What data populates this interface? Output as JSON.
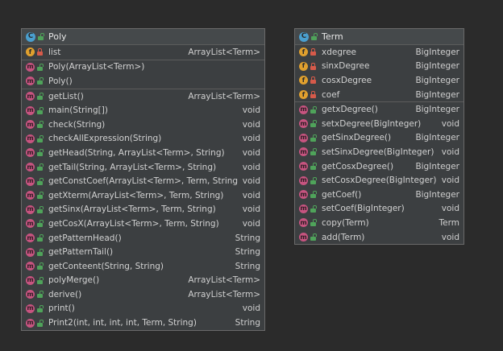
{
  "poly": {
    "title": "Poly",
    "fields": [
      {
        "name": "list",
        "type": "ArrayList<Term>",
        "visibility": "private"
      }
    ],
    "constructors": [
      {
        "name": "Poly(ArrayList<Term>)",
        "type": "",
        "visibility": "public"
      },
      {
        "name": "Poly()",
        "type": "",
        "visibility": "public"
      }
    ],
    "methods": [
      {
        "name": "getList()",
        "type": "ArrayList<Term>",
        "visibility": "public"
      },
      {
        "name": "main(String[])",
        "type": "void",
        "visibility": "public"
      },
      {
        "name": "check(String)",
        "type": "void",
        "visibility": "public"
      },
      {
        "name": "checkAllExpression(String)",
        "type": "void",
        "visibility": "public"
      },
      {
        "name": "getHead(String, ArrayList<Term>, String)",
        "type": "void",
        "visibility": "public"
      },
      {
        "name": "getTail(String, ArrayList<Term>, String)",
        "type": "void",
        "visibility": "public"
      },
      {
        "name": "getConstCoef(ArrayList<Term>, Term, String)",
        "type": "void",
        "visibility": "public"
      },
      {
        "name": "getXterm(ArrayList<Term>, Term, String)",
        "type": "void",
        "visibility": "public"
      },
      {
        "name": "getSinx(ArrayList<Term>, Term, String)",
        "type": "void",
        "visibility": "public"
      },
      {
        "name": "getCosX(ArrayList<Term>, Term, String)",
        "type": "void",
        "visibility": "public"
      },
      {
        "name": "getPatternHead()",
        "type": "String",
        "visibility": "public"
      },
      {
        "name": "getPatternTail()",
        "type": "String",
        "visibility": "public"
      },
      {
        "name": "getConteent(String, String)",
        "type": "String",
        "visibility": "public"
      },
      {
        "name": "polyMerge()",
        "type": "ArrayList<Term>",
        "visibility": "public"
      },
      {
        "name": "derive()",
        "type": "ArrayList<Term>",
        "visibility": "public"
      },
      {
        "name": "print()",
        "type": "void",
        "visibility": "public"
      },
      {
        "name": "Print2(int, int, int, int, Term, String)",
        "type": "String",
        "visibility": "public"
      }
    ]
  },
  "term": {
    "title": "Term",
    "fields": [
      {
        "name": "xdegree",
        "type": "BigInteger",
        "visibility": "private"
      },
      {
        "name": "sinxDegree",
        "type": "BigInteger",
        "visibility": "private"
      },
      {
        "name": "cosxDegree",
        "type": "BigInteger",
        "visibility": "private"
      },
      {
        "name": "coef",
        "type": "BigInteger",
        "visibility": "private"
      }
    ],
    "methods": [
      {
        "name": "getxDegree()",
        "type": "BigInteger",
        "visibility": "public"
      },
      {
        "name": "setxDegree(BigInteger)",
        "type": "void",
        "visibility": "public"
      },
      {
        "name": "getSinxDegree()",
        "type": "BigInteger",
        "visibility": "public"
      },
      {
        "name": "setSinxDegree(BigInteger)",
        "type": "void",
        "visibility": "public"
      },
      {
        "name": "getCosxDegree()",
        "type": "BigInteger",
        "visibility": "public"
      },
      {
        "name": "setCosxDegree(BigInteger)",
        "type": "void",
        "visibility": "public"
      },
      {
        "name": "getCoef()",
        "type": "BigInteger",
        "visibility": "public"
      },
      {
        "name": "setCoef(BigInteger)",
        "type": "void",
        "visibility": "public"
      },
      {
        "name": "copy(Term)",
        "type": "Term",
        "visibility": "public"
      },
      {
        "name": "add(Term)",
        "type": "void",
        "visibility": "public"
      }
    ]
  },
  "icons": {
    "class_letter": "C",
    "field_letter": "f",
    "method_letter": "m"
  },
  "colors": {
    "background": "#2b2b2b",
    "class_icon": "#4a9fcf",
    "field_icon": "#e0a02e",
    "method_icon": "#c75480",
    "private_lock": "#d65a4a",
    "public_lock": "#4fa35a"
  }
}
